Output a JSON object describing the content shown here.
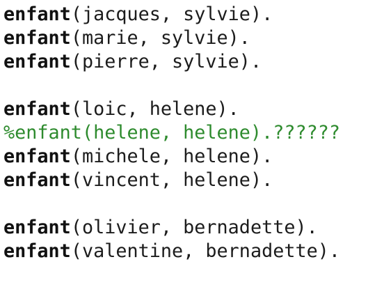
{
  "editor": {
    "lines": [
      {
        "type": "fact",
        "keyword": "enfant",
        "args": "(jacques, sylvie)."
      },
      {
        "type": "fact",
        "keyword": "enfant",
        "args": "(marie, sylvie)."
      },
      {
        "type": "fact",
        "keyword": "enfant",
        "args": "(pierre, sylvie)."
      },
      {
        "type": "blank"
      },
      {
        "type": "fact",
        "keyword": "enfant",
        "args": "(loic, helene)."
      },
      {
        "type": "comment",
        "text": "%enfant(helene, helene).??????"
      },
      {
        "type": "fact",
        "keyword": "enfant",
        "args": "(michele, helene)."
      },
      {
        "type": "fact",
        "keyword": "enfant",
        "args": "(vincent, helene)."
      },
      {
        "type": "blank"
      },
      {
        "type": "fact",
        "keyword": "enfant",
        "args": "(olivier, bernadette)."
      },
      {
        "type": "fact",
        "keyword": "enfant",
        "args": "(valentine, bernadette)."
      }
    ]
  },
  "colors": {
    "background": "#ffffff",
    "text": "#1c1c1c",
    "comment": "#2e8b2e"
  }
}
